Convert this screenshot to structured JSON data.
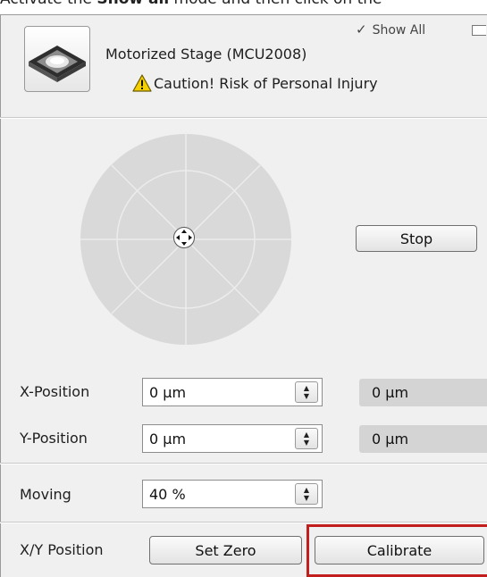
{
  "caption": {
    "prefix": "Activate the ",
    "bold": "Show all",
    "suffix": " mode and then click on the"
  },
  "header": {
    "show_all_check": "✓",
    "show_all_label": "Show All",
    "title": "Motorized Stage (MCU2008)",
    "caution": "Caution! Risk of Personal Injury"
  },
  "icons": {
    "stage": "stage-icon",
    "warning": "warning-icon",
    "joystick_center": "move-arrows-icon",
    "undock": "undock-icon"
  },
  "controls": {
    "stop_label": "Stop"
  },
  "x_position": {
    "label": "X-Position",
    "value": "0 µm",
    "readout": "0 µm"
  },
  "y_position": {
    "label": "Y-Position",
    "value": "0 µm",
    "readout": "0 µm"
  },
  "moving": {
    "label": "Moving",
    "value": "40 %"
  },
  "xy_position": {
    "label": "X/Y Position",
    "set_zero_label": "Set Zero",
    "calibrate_label": "Calibrate"
  },
  "colors": {
    "panel_bg": "#f0f0f0",
    "joystick": "#d9d9d9",
    "highlight": "#c21e1e",
    "warning": "#f5d000"
  }
}
